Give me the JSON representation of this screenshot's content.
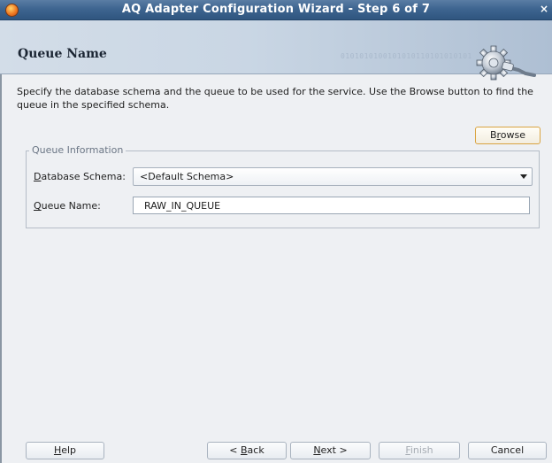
{
  "window": {
    "title": "AQ Adapter Configuration Wizard - Step 6 of 7",
    "close_glyph": "×"
  },
  "header": {
    "page_title": "Queue Name",
    "binary_pattern": "0101010100101010110101010101"
  },
  "description": "Specify the database schema and the queue to be used for the service. Use the Browse button to find the queue in the specified schema.",
  "browse_button": {
    "pre": "B",
    "mnemonic": "r",
    "post": "owse"
  },
  "queue_information": {
    "legend": "Queue Information",
    "database_schema": {
      "label_mnemonic": "D",
      "label_rest": "atabase Schema:",
      "selected": "<Default Schema>"
    },
    "queue_name": {
      "label_mnemonic": "Q",
      "label_rest": "ueue Name:",
      "value": "RAW_IN_QUEUE"
    }
  },
  "footer": {
    "help": {
      "mnemonic": "H",
      "rest": "elp"
    },
    "back": {
      "pre": "< ",
      "mnemonic": "B",
      "rest": "ack"
    },
    "next": {
      "mnemonic": "N",
      "rest": "ext >"
    },
    "finish": {
      "mnemonic": "F",
      "rest": "inish"
    },
    "cancel": "Cancel"
  },
  "colors": {
    "titlebar": "#3e6590",
    "header": "#c9d6e4",
    "background": "#eef0f3",
    "browse_border": "#d9a441"
  },
  "icons": [
    "app-icon",
    "close-icon",
    "gear-plug-icon",
    "dropdown-arrow-icon"
  ]
}
